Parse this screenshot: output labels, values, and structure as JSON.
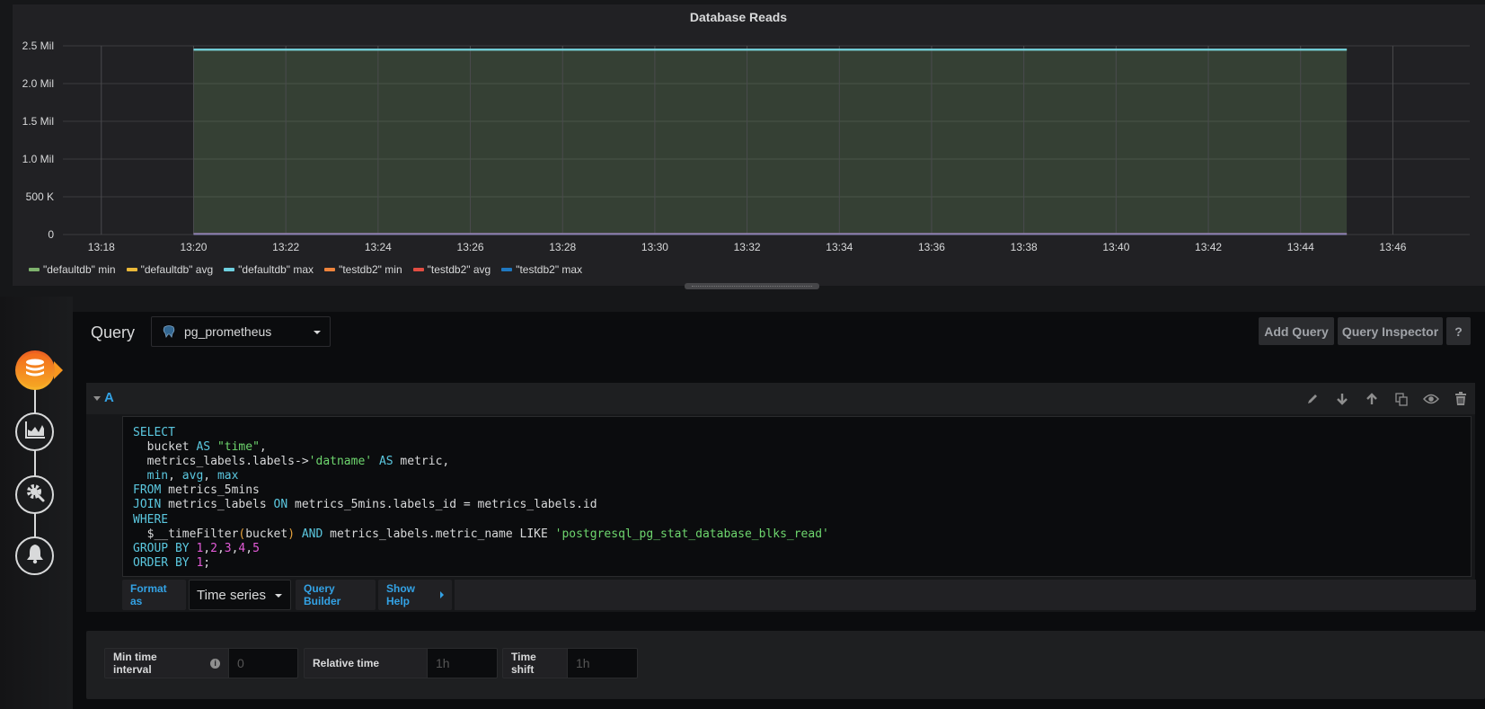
{
  "graph": {
    "title": "Database Reads",
    "legend": [
      {
        "label": "\"defaultdb\" min",
        "color": "#7eb26d"
      },
      {
        "label": "\"defaultdb\" avg",
        "color": "#eab839"
      },
      {
        "label": "\"defaultdb\" max",
        "color": "#6ed0e0"
      },
      {
        "label": "\"testdb2\" min",
        "color": "#ef843c"
      },
      {
        "label": "\"testdb2\" avg",
        "color": "#e24d42"
      },
      {
        "label": "\"testdb2\" max",
        "color": "#1f78c1"
      }
    ]
  },
  "chart_data": {
    "type": "area",
    "title": "Database Reads",
    "xlabel": "",
    "ylabel": "",
    "x_ticks": [
      "13:18",
      "13:20",
      "13:22",
      "13:24",
      "13:26",
      "13:28",
      "13:30",
      "13:32",
      "13:34",
      "13:36",
      "13:38",
      "13:40",
      "13:42",
      "13:44",
      "13:46"
    ],
    "y_ticks": [
      "0",
      "500 K",
      "1.0 Mil",
      "1.5 Mil",
      "2.0 Mil",
      "2.5 Mil"
    ],
    "ylim": [
      0,
      2500000
    ],
    "xlim_minutes": [
      "13:17:10",
      "13:47:40"
    ],
    "grid": true,
    "legend_position": "bottom-left",
    "series": [
      {
        "name": "\"defaultdb\" min",
        "color": "#7eb26d",
        "x": [
          "13:20",
          "13:45"
        ],
        "values": [
          2450000,
          2450000
        ]
      },
      {
        "name": "\"defaultdb\" avg",
        "color": "#eab839",
        "x": [
          "13:20",
          "13:45"
        ],
        "values": [
          2450000,
          2450000
        ]
      },
      {
        "name": "\"defaultdb\" max",
        "color": "#6ed0e0",
        "x": [
          "13:20",
          "13:45"
        ],
        "values": [
          2450000,
          2450000
        ]
      },
      {
        "name": "\"testdb2\" min",
        "color": "#ef843c",
        "x": [
          "13:20",
          "13:45"
        ],
        "values": [
          8000,
          8000
        ]
      },
      {
        "name": "\"testdb2\" avg",
        "color": "#e24d42",
        "x": [
          "13:20",
          "13:45"
        ],
        "values": [
          8000,
          8000
        ]
      },
      {
        "name": "\"testdb2\" max",
        "color": "#1f78c1",
        "x": [
          "13:20",
          "13:45"
        ],
        "values": [
          8000,
          8000
        ]
      }
    ]
  },
  "sidebar": {
    "items": [
      {
        "name": "queries",
        "icon": "database-icon",
        "active": true
      },
      {
        "name": "visualization",
        "icon": "area-chart-icon",
        "active": false
      },
      {
        "name": "general",
        "icon": "gear-wrench-icon",
        "active": false
      },
      {
        "name": "alert",
        "icon": "bell-icon",
        "active": false
      }
    ]
  },
  "query": {
    "label": "Query",
    "datasource": "pg_prometheus",
    "add_query": "Add Query",
    "query_inspector": "Query Inspector",
    "help": "?"
  },
  "row_a": {
    "ref_id": "A",
    "icons": [
      "pencil-icon",
      "arrow-down-icon",
      "arrow-up-icon",
      "duplicate-icon",
      "eye-icon",
      "trash-icon"
    ],
    "sql_lines": [
      "SELECT",
      "  bucket AS \"time\",",
      "  metrics_labels.labels->'datname' AS metric,",
      "  min, avg, max",
      "FROM metrics_5mins",
      "JOIN metrics_labels ON metrics_5mins.labels_id = metrics_labels.id",
      "WHERE",
      "  $__timeFilter(bucket) AND metrics_labels.metric_name LIKE 'postgresql_pg_stat_database_blks_read'",
      "GROUP BY 1,2,3,4,5",
      "ORDER BY 1;"
    ],
    "format_as_label": "Format as",
    "format_as_value": "Time series",
    "query_builder": "Query Builder",
    "show_help": "Show Help"
  },
  "options": {
    "min_time_interval_label": "Min time interval",
    "min_time_interval_placeholder": "0",
    "relative_time_label": "Relative time",
    "relative_time_placeholder": "1h",
    "time_shift_label": "Time shift",
    "time_shift_placeholder": "1h"
  }
}
